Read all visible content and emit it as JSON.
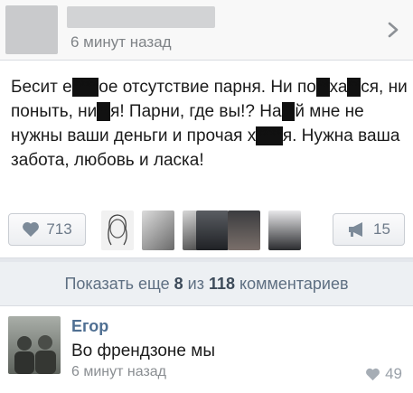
{
  "post": {
    "time": "6 минут назад",
    "text_parts": [
      "Бесит е",
      "****",
      "ое отсутствие парня. Ни по",
      "**",
      "ха",
      "**",
      "ся, ни поныть, ни",
      "**",
      "я! Парни, где вы!? На",
      "**",
      "й мне не нужны ваши деньги и прочая х",
      "****",
      "я. Нужна ваша забота, любовь и ласка!"
    ],
    "likes": "713",
    "shares": "15"
  },
  "more_comments": {
    "prefix": "Показать еще",
    "shown": "8",
    "middle": "из",
    "total": "118",
    "suffix": "комментариев"
  },
  "comment": {
    "author": "Егор",
    "text": "Во френдзоне мы",
    "time": "6 минут назад",
    "likes": "49"
  },
  "icons": {
    "chevron": "chevron-right-icon",
    "like": "heart-icon",
    "share": "megaphone-icon"
  }
}
